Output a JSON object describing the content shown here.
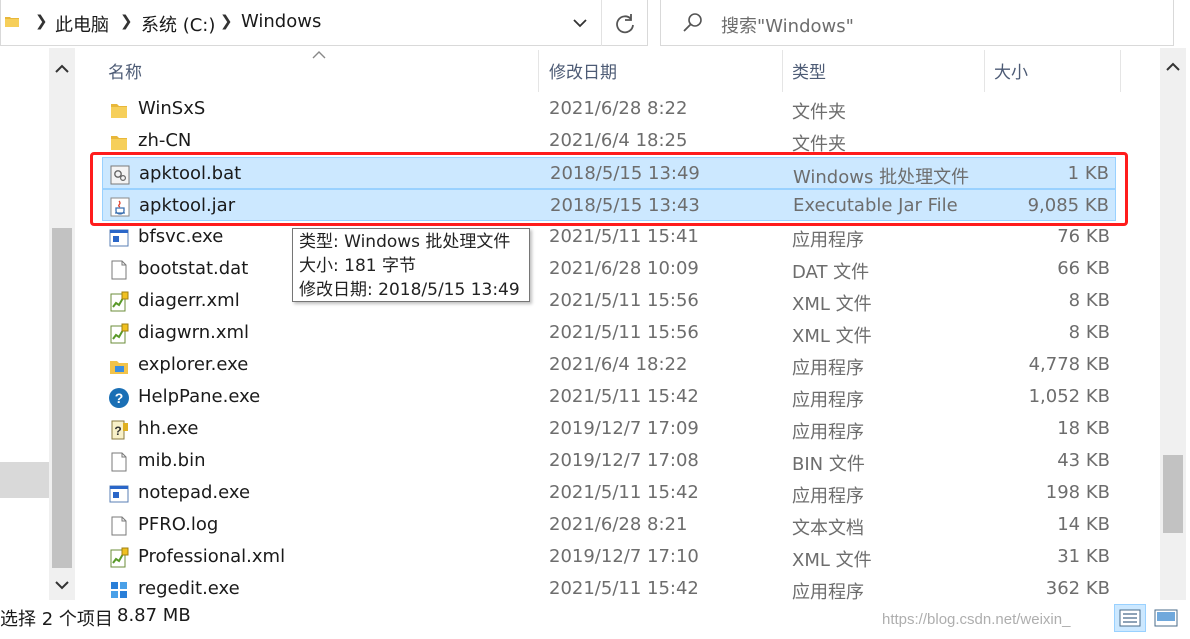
{
  "breadcrumb": [
    "此电脑",
    "系统 (C:)",
    "Windows"
  ],
  "search": {
    "placeholder": "搜索\"Windows\""
  },
  "columns": {
    "name": "名称",
    "date": "修改日期",
    "type": "类型",
    "size": "大小"
  },
  "files": [
    {
      "name": "WinSxS",
      "date": "2021/6/28 8:22",
      "type": "文件夹",
      "size": "",
      "icon": "folder-icon",
      "selected": false
    },
    {
      "name": "zh-CN",
      "date": "2021/6/4 18:25",
      "type": "文件夹",
      "size": "",
      "icon": "folder-icon",
      "selected": false
    },
    {
      "name": "apktool.bat",
      "date": "2018/5/15 13:49",
      "type": "Windows 批处理文件",
      "size": "1 KB",
      "icon": "batch-file-icon",
      "selected": true
    },
    {
      "name": "apktool.jar",
      "date": "2018/5/15 13:43",
      "type": "Executable Jar File",
      "size": "9,085 KB",
      "icon": "java-jar-icon",
      "selected": true
    },
    {
      "name": "bfsvc.exe",
      "date": "2021/5/11 15:41",
      "type": "应用程序",
      "size": "76 KB",
      "icon": "app-window-icon",
      "selected": false
    },
    {
      "name": "bootstat.dat",
      "date": "2021/6/28 10:09",
      "type": "DAT 文件",
      "size": "66 KB",
      "icon": "blank-file-icon",
      "selected": false
    },
    {
      "name": "diagerr.xml",
      "date": "2021/5/11 15:56",
      "type": "XML 文件",
      "size": "8 KB",
      "icon": "xml-file-icon",
      "selected": false
    },
    {
      "name": "diagwrn.xml",
      "date": "2021/5/11 15:56",
      "type": "XML 文件",
      "size": "8 KB",
      "icon": "xml-file-icon",
      "selected": false
    },
    {
      "name": "explorer.exe",
      "date": "2021/6/4 18:22",
      "type": "应用程序",
      "size": "4,778 KB",
      "icon": "explorer-icon",
      "selected": false
    },
    {
      "name": "HelpPane.exe",
      "date": "2021/5/11 15:42",
      "type": "应用程序",
      "size": "1,052 KB",
      "icon": "help-icon",
      "selected": false
    },
    {
      "name": "hh.exe",
      "date": "2019/12/7 17:09",
      "type": "应用程序",
      "size": "18 KB",
      "icon": "help-document-icon",
      "selected": false
    },
    {
      "name": "mib.bin",
      "date": "2019/12/7 17:08",
      "type": "BIN 文件",
      "size": "43 KB",
      "icon": "blank-file-icon",
      "selected": false
    },
    {
      "name": "notepad.exe",
      "date": "2021/5/11 15:42",
      "type": "应用程序",
      "size": "198 KB",
      "icon": "app-window-icon",
      "selected": false
    },
    {
      "name": "PFRO.log",
      "date": "2021/6/28 8:21",
      "type": "文本文档",
      "size": "14 KB",
      "icon": "blank-file-icon",
      "selected": false
    },
    {
      "name": "Professional.xml",
      "date": "2019/12/7 17:10",
      "type": "XML 文件",
      "size": "31 KB",
      "icon": "xml-file-icon",
      "selected": false
    },
    {
      "name": "regedit.exe",
      "date": "2021/5/11 15:42",
      "type": "应用程序",
      "size": "362 KB",
      "icon": "registry-editor-icon",
      "selected": false
    }
  ],
  "tooltip": {
    "type_line": "类型: Windows 批处理文件",
    "size_line": "大小: 181 字节",
    "date_line": "修改日期: 2018/5/15 13:49"
  },
  "status": {
    "selection": "选择 2 个项目",
    "size": "8.87 MB"
  },
  "watermark": "https://blog.csdn.net/weixin_",
  "colors": {
    "selection_bg": "#cce8ff",
    "selection_border": "#99d1ff",
    "highlight_box": "#ff1c1c",
    "header_text": "#4d5b75",
    "secondary_text": "#6d6d6d"
  }
}
